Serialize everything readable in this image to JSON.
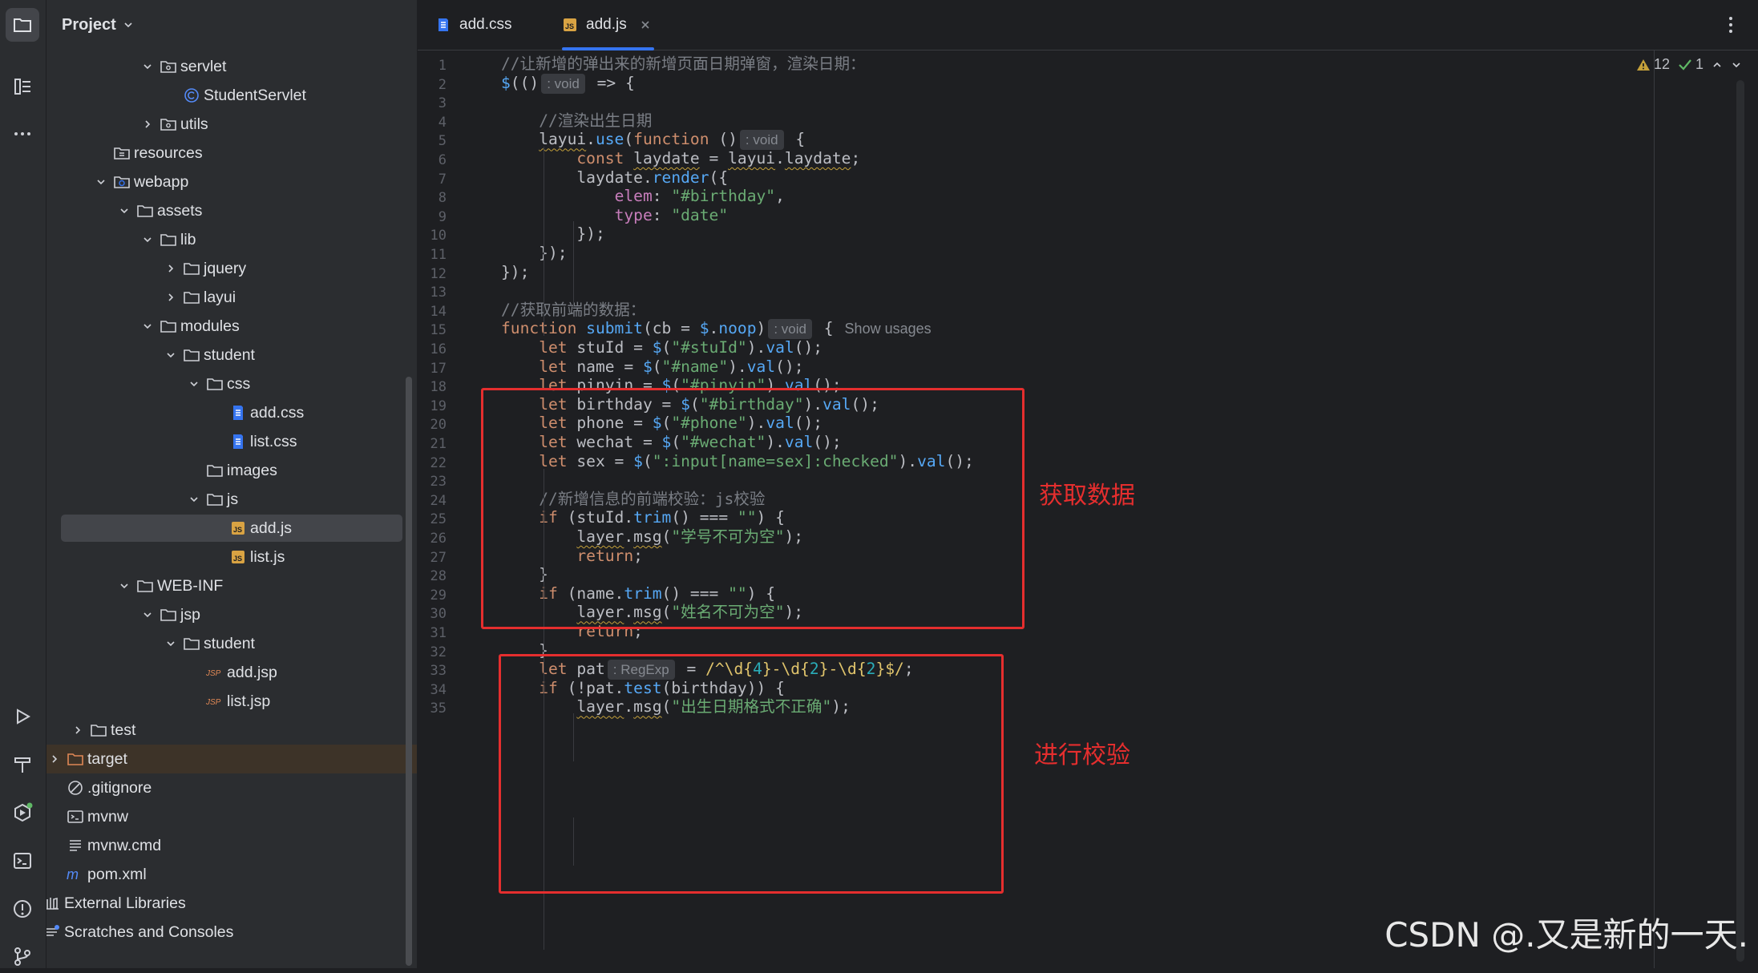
{
  "project_panel": {
    "title": "Project",
    "tree": [
      {
        "label": "servlet",
        "icon": "package-folder-icon",
        "arrow": "down",
        "indent": 0
      },
      {
        "label": "StudentServlet",
        "icon": "class-icon",
        "arrow": "none",
        "indent": 1
      },
      {
        "label": "utils",
        "icon": "package-folder-icon",
        "arrow": "right",
        "indent": 0
      },
      {
        "label": "resources",
        "icon": "resources-folder-icon",
        "arrow": "none",
        "indent": -2
      },
      {
        "label": "webapp",
        "icon": "web-folder-icon",
        "arrow": "down",
        "indent": -2
      },
      {
        "label": "assets",
        "icon": "folder-icon",
        "arrow": "down",
        "indent": -1
      },
      {
        "label": "lib",
        "icon": "folder-icon",
        "arrow": "down",
        "indent": 0
      },
      {
        "label": "jquery",
        "icon": "folder-icon",
        "arrow": "right",
        "indent": 1
      },
      {
        "label": "layui",
        "icon": "folder-icon",
        "arrow": "right",
        "indent": 1
      },
      {
        "label": "modules",
        "icon": "folder-icon",
        "arrow": "down",
        "indent": 0
      },
      {
        "label": "student",
        "icon": "folder-icon",
        "arrow": "down",
        "indent": 1
      },
      {
        "label": "css",
        "icon": "folder-icon",
        "arrow": "down",
        "indent": 2
      },
      {
        "label": "add.css",
        "icon": "css-file-icon",
        "arrow": "none",
        "indent": 3
      },
      {
        "label": "list.css",
        "icon": "css-file-icon",
        "arrow": "none",
        "indent": 3
      },
      {
        "label": "images",
        "icon": "folder-icon",
        "arrow": "none",
        "indent": 2
      },
      {
        "label": "js",
        "icon": "folder-icon",
        "arrow": "down",
        "indent": 2
      },
      {
        "label": "add.js",
        "icon": "js-file-icon",
        "arrow": "none",
        "indent": 3,
        "selected": true
      },
      {
        "label": "list.js",
        "icon": "js-file-icon",
        "arrow": "none",
        "indent": 3
      },
      {
        "label": "WEB-INF",
        "icon": "folder-icon",
        "arrow": "down",
        "indent": -1
      },
      {
        "label": "jsp",
        "icon": "folder-icon",
        "arrow": "down",
        "indent": 0
      },
      {
        "label": "student",
        "icon": "folder-icon",
        "arrow": "down",
        "indent": 1
      },
      {
        "label": "add.jsp",
        "icon": "jsp-file-icon",
        "arrow": "none",
        "indent": 2
      },
      {
        "label": "list.jsp",
        "icon": "jsp-file-icon",
        "arrow": "none",
        "indent": 2
      },
      {
        "label": "test",
        "icon": "folder-icon",
        "arrow": "right",
        "indent": -3
      },
      {
        "label": "target",
        "icon": "excluded-folder-icon",
        "arrow": "right",
        "indent": -4,
        "excluded": true
      },
      {
        "label": ".gitignore",
        "icon": "ignore-file-icon",
        "arrow": "none",
        "indent": -4
      },
      {
        "label": "mvnw",
        "icon": "script-file-icon",
        "arrow": "none",
        "indent": -4
      },
      {
        "label": "mvnw.cmd",
        "icon": "text-file-icon",
        "arrow": "none",
        "indent": -4
      },
      {
        "label": "pom.xml",
        "icon": "maven-file-icon",
        "arrow": "none",
        "indent": -4
      },
      {
        "label": "External Libraries",
        "icon": "library-icon",
        "arrow": "right",
        "indent": -5
      },
      {
        "label": "Scratches and Consoles",
        "icon": "scratches-icon",
        "arrow": "right",
        "indent": -5
      }
    ]
  },
  "tabs": [
    {
      "label": "add.css",
      "icon": "css-file-icon",
      "active": false
    },
    {
      "label": "add.js",
      "icon": "js-file-icon",
      "active": true,
      "closable": true
    }
  ],
  "inspections": {
    "warnings": "12",
    "ok": "1"
  },
  "code_lines": [
    {
      "n": "1",
      "html": "<span class=\"cm\">//让新增的弹出来的新增页面日期弹窗，渲染日期：</span>"
    },
    {
      "n": "2",
      "html": "<span class=\"fn\">$</span>(()<span class=\"hint\">: void</span> =&gt; {"
    },
    {
      "n": "3",
      "html": ""
    },
    {
      "n": "4",
      "html": "    <span class=\"cm\">//渲染出生日期</span>"
    },
    {
      "n": "5",
      "html": "    <span class=\"wavy\">layui</span>.<span class=\"fn\">use</span>(<span class=\"kw\">function</span> ()<span class=\"hint\">: void</span> {"
    },
    {
      "n": "6",
      "html": "        <span class=\"kw\">const</span> <span class=\"wavy\">laydate</span> = <span class=\"wavy\">layui</span>.<span class=\"wavy\">laydate</span>;"
    },
    {
      "n": "7",
      "html": "        laydate.<span class=\"fn\">render</span>({"
    },
    {
      "n": "8",
      "html": "            <span class=\"pr\">elem</span>: <span class=\"st\">\"#birthday\"</span>,"
    },
    {
      "n": "9",
      "html": "            <span class=\"pr\">type</span>: <span class=\"st\">\"date\"</span>"
    },
    {
      "n": "10",
      "html": "        });"
    },
    {
      "n": "11",
      "html": "    });"
    },
    {
      "n": "12",
      "html": "});"
    },
    {
      "n": "13",
      "html": ""
    },
    {
      "n": "14",
      "html": "<span class=\"cm\">//获取前端的数据：</span>"
    },
    {
      "n": "15",
      "html": "<span class=\"kw\">function</span> <span class=\"fn\">submit</span>(cb = <span class=\"fn\">$</span>.<span class=\"fn\">noop</span>)<span class=\"hint\">: void</span> {<span class=\"usage\">Show usages</span>"
    },
    {
      "n": "16",
      "html": "    <span class=\"kw\">let</span> stuId = <span class=\"fn\">$</span>(<span class=\"st\">\"#stuId\"</span>).<span class=\"fn\">val</span>();"
    },
    {
      "n": "17",
      "html": "    <span class=\"kw\">let</span> name = <span class=\"fn\">$</span>(<span class=\"st\">\"#name\"</span>).<span class=\"fn\">val</span>();"
    },
    {
      "n": "18",
      "html": "    <span class=\"kw\">let</span> pinyin = <span class=\"fn\">$</span>(<span class=\"st\">\"#pinyin\"</span>).<span class=\"fn\">val</span>();"
    },
    {
      "n": "19",
      "html": "    <span class=\"kw\">let</span> birthday = <span class=\"fn\">$</span>(<span class=\"st\">\"#birthday\"</span>).<span class=\"fn\">val</span>();"
    },
    {
      "n": "20",
      "html": "    <span class=\"kw\">let</span> phone = <span class=\"fn\">$</span>(<span class=\"st\">\"#phone\"</span>).<span class=\"fn\">val</span>();"
    },
    {
      "n": "21",
      "html": "    <span class=\"kw\">let</span> wechat = <span class=\"fn\">$</span>(<span class=\"st\">\"#wechat\"</span>).<span class=\"fn\">val</span>();"
    },
    {
      "n": "22",
      "html": "    <span class=\"kw\">let</span> sex = <span class=\"fn\">$</span>(<span class=\"st\">\":input[name=sex]:checked\"</span>).<span class=\"fn\">val</span>();"
    },
    {
      "n": "23",
      "html": ""
    },
    {
      "n": "24",
      "html": "    <span class=\"cm\">//新增信息的前端校验：js校验</span>"
    },
    {
      "n": "25",
      "html": "    <span class=\"kw\">if</span> (stuId.<span class=\"fn\">trim</span>() === <span class=\"st\">\"\"</span>) {"
    },
    {
      "n": "26",
      "html": "        <span class=\"wavy\">layer</span>.<span class=\"wavy\">msg</span>(<span class=\"st\">\"学号不可为空\"</span>);"
    },
    {
      "n": "27",
      "html": "        <span class=\"kw\">return</span>;"
    },
    {
      "n": "28",
      "html": "    }"
    },
    {
      "n": "29",
      "html": "    <span class=\"kw\">if</span> (name.<span class=\"fn\">trim</span>() === <span class=\"st\">\"\"</span>) {"
    },
    {
      "n": "30",
      "html": "        <span class=\"wavy\">layer</span>.<span class=\"wavy\">msg</span>(<span class=\"st\">\"姓名不可为空\"</span>);"
    },
    {
      "n": "31",
      "html": "        <span class=\"kw\">return</span>;"
    },
    {
      "n": "32",
      "html": "    }"
    },
    {
      "n": "33",
      "html": "    <span class=\"kw\">let</span> pat<span class=\"hint\">: RegExp</span> = <span class=\"rx\">/^\\d{</span><span class=\"num\">4</span><span class=\"rx\">}-\\d{</span><span class=\"num\">2</span><span class=\"rx\">}-\\d{</span><span class=\"num\">2</span><span class=\"rx\">}$/</span>;"
    },
    {
      "n": "34",
      "html": "    <span class=\"kw\">if</span> (!pat.<span class=\"fn\">test</span>(birthday)) {"
    },
    {
      "n": "35",
      "html": "        <span class=\"wavy\">layer</span>.<span class=\"wavy\">msg</span>(<span class=\"st\">\"出生日期格式不正确\"</span>);"
    }
  ],
  "annotations": {
    "box1_label": "获取数据",
    "box2_label": "进行校验"
  },
  "watermark": "CSDN @.又是新的一天."
}
